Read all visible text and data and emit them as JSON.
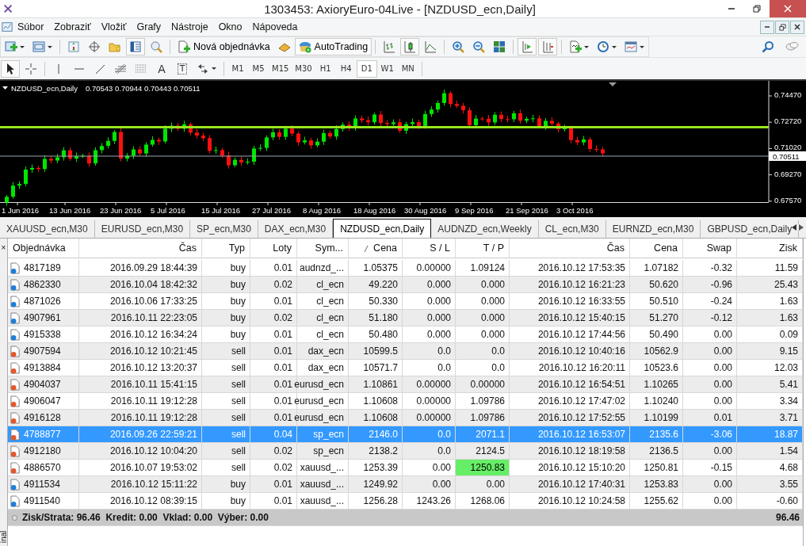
{
  "window": {
    "title": "1303453: AxioryEuro-04Live - [NZDUSD_ecn,Daily]"
  },
  "menu": [
    "Súbor",
    "Zobraziť",
    "Vložiť",
    "Grafy",
    "Nástroje",
    "Okno",
    "Nápoveda"
  ],
  "toolbar": {
    "new_order": "Nová objednávka",
    "autotrading": "AutoTrading"
  },
  "drawing_tools": {
    "text_tool": "A",
    "label_tool": "T"
  },
  "timeframes": [
    {
      "label": "M1",
      "selected": false
    },
    {
      "label": "M5",
      "selected": false
    },
    {
      "label": "M15",
      "selected": false
    },
    {
      "label": "M30",
      "selected": false
    },
    {
      "label": "H1",
      "selected": false
    },
    {
      "label": "H4",
      "selected": false
    },
    {
      "label": "D1",
      "selected": true
    },
    {
      "label": "W1",
      "selected": false
    },
    {
      "label": "MN",
      "selected": false
    }
  ],
  "chart": {
    "symbol": "NZDUSD_ecn,Daily",
    "ohlc": "0.70543 0.70944 0.70443 0.70511",
    "price_labels": [
      "0.74470",
      "0.72720",
      "0.71020",
      "0.69270",
      "0.67570"
    ],
    "current_price": "0.70511",
    "date_labels": [
      "1 Jun 2016",
      "13 Jun 2016",
      "23 Jun 2016",
      "5 Jul 2016",
      "15 Jul 2016",
      "27 Jul 2016",
      "8 Aug 2016",
      "18 Aug 2016",
      "30 Aug 2016",
      "9 Sep 2016",
      "21 Sep 2016",
      "3 Oct 2016"
    ]
  },
  "chart_tabs": [
    {
      "label": "XAUUSD_ecn,M30",
      "selected": false
    },
    {
      "label": "EURUSD_ecn,M30",
      "selected": false
    },
    {
      "label": "SP_ecn,M30",
      "selected": false
    },
    {
      "label": "DAX_ecn,M30",
      "selected": false
    },
    {
      "label": "NZDUSD_ecn,Daily",
      "selected": true
    },
    {
      "label": "AUDNZD_ecn,Weekly",
      "selected": false
    },
    {
      "label": "CL_ecn,M30",
      "selected": false
    },
    {
      "label": "EURNZD_ecn,M30",
      "selected": false
    },
    {
      "label": "GBPUSD_ecn,Daily",
      "selected": false
    }
  ],
  "terminal": {
    "side_label": "inal",
    "close": "×",
    "columns": [
      "Objednávka",
      "Čas",
      "Typ",
      "Loty",
      "Sym...",
      "Cena",
      "S / L",
      "T / P",
      "Čas",
      "Cena",
      "Swap",
      "Zisk"
    ],
    "rows": [
      {
        "kind": "buy",
        "order": "4817189",
        "open_time": "2016.09.29 18:44:39",
        "type": "buy",
        "lots": "0.01",
        "symbol": "audnzd_...",
        "open_price": "1.05375",
        "sl": "0.00000",
        "tp": "1.09124",
        "time": "2016.10.12 17:53:35",
        "price": "1.07182",
        "swap": "-0.32",
        "profit": "11.59",
        "selected": false,
        "tp_hit": false
      },
      {
        "kind": "buy",
        "order": "4862330",
        "open_time": "2016.10.04 18:42:32",
        "type": "buy",
        "lots": "0.02",
        "symbol": "cl_ecn",
        "open_price": "49.220",
        "sl": "0.000",
        "tp": "0.000",
        "time": "2016.10.12 16:21:23",
        "price": "50.620",
        "swap": "-0.96",
        "profit": "25.43",
        "selected": false,
        "tp_hit": false
      },
      {
        "kind": "buy",
        "order": "4871026",
        "open_time": "2016.10.06 17:33:25",
        "type": "buy",
        "lots": "0.01",
        "symbol": "cl_ecn",
        "open_price": "50.330",
        "sl": "0.000",
        "tp": "0.000",
        "time": "2016.10.12 16:33:55",
        "price": "50.510",
        "swap": "-0.24",
        "profit": "1.63",
        "selected": false,
        "tp_hit": false
      },
      {
        "kind": "buy",
        "order": "4907961",
        "open_time": "2016.10.11 22:23:05",
        "type": "buy",
        "lots": "0.02",
        "symbol": "cl_ecn",
        "open_price": "51.180",
        "sl": "0.000",
        "tp": "0.000",
        "time": "2016.10.12 15:40:15",
        "price": "51.270",
        "swap": "-0.12",
        "profit": "1.63",
        "selected": false,
        "tp_hit": false
      },
      {
        "kind": "buy",
        "order": "4915338",
        "open_time": "2016.10.12 16:34:24",
        "type": "buy",
        "lots": "0.01",
        "symbol": "cl_ecn",
        "open_price": "50.480",
        "sl": "0.000",
        "tp": "0.000",
        "time": "2016.10.12 17:44:56",
        "price": "50.490",
        "swap": "0.00",
        "profit": "0.09",
        "selected": false,
        "tp_hit": false
      },
      {
        "kind": "sell",
        "order": "4907594",
        "open_time": "2016.10.12 10:21:45",
        "type": "sell",
        "lots": "0.01",
        "symbol": "dax_ecn",
        "open_price": "10599.5",
        "sl": "0.0",
        "tp": "0.0",
        "time": "2016.10.12 10:40:16",
        "price": "10562.9",
        "swap": "0.00",
        "profit": "9.15",
        "selected": false,
        "tp_hit": false
      },
      {
        "kind": "sell",
        "order": "4913884",
        "open_time": "2016.10.12 13:20:37",
        "type": "sell",
        "lots": "0.01",
        "symbol": "dax_ecn",
        "open_price": "10571.7",
        "sl": "0.0",
        "tp": "0.0",
        "time": "2016.10.12 16:20:11",
        "price": "10523.6",
        "swap": "0.00",
        "profit": "12.03",
        "selected": false,
        "tp_hit": false
      },
      {
        "kind": "sell",
        "order": "4904037",
        "open_time": "2016.10.11 15:41:15",
        "type": "sell",
        "lots": "0.01",
        "symbol": "eurusd_ecn",
        "open_price": "1.10861",
        "sl": "0.00000",
        "tp": "0.00000",
        "time": "2016.10.12 16:54:51",
        "price": "1.10265",
        "swap": "0.00",
        "profit": "5.41",
        "selected": false,
        "tp_hit": false
      },
      {
        "kind": "sell",
        "order": "4906047",
        "open_time": "2016.10.11 19:12:28",
        "type": "sell",
        "lots": "0.01",
        "symbol": "eurusd_ecn",
        "open_price": "1.10608",
        "sl": "0.00000",
        "tp": "1.09786",
        "time": "2016.10.12 17:47:02",
        "price": "1.10240",
        "swap": "0.00",
        "profit": "3.34",
        "selected": false,
        "tp_hit": false
      },
      {
        "kind": "sell",
        "order": "4916128",
        "open_time": "2016.10.11 19:12:28",
        "type": "sell",
        "lots": "0.01",
        "symbol": "eurusd_ecn",
        "open_price": "1.10608",
        "sl": "0.00000",
        "tp": "1.09786",
        "time": "2016.10.12 17:52:55",
        "price": "1.10199",
        "swap": "0.01",
        "profit": "3.71",
        "selected": false,
        "tp_hit": false
      },
      {
        "kind": "sell",
        "order": "4788877",
        "open_time": "2016.09.26 22:59:21",
        "type": "sell",
        "lots": "0.04",
        "symbol": "sp_ecn",
        "open_price": "2146.0",
        "sl": "0.0",
        "tp": "2071.1",
        "time": "2016.10.12 16:53:07",
        "price": "2135.6",
        "swap": "-3.06",
        "profit": "18.87",
        "selected": true,
        "tp_hit": false
      },
      {
        "kind": "sell",
        "order": "4912180",
        "open_time": "2016.10.12 10:04:20",
        "type": "sell",
        "lots": "0.02",
        "symbol": "sp_ecn",
        "open_price": "2138.2",
        "sl": "0.0",
        "tp": "2124.5",
        "time": "2016.10.12 18:19:58",
        "price": "2136.5",
        "swap": "0.00",
        "profit": "1.54",
        "selected": false,
        "tp_hit": false
      },
      {
        "kind": "sell",
        "order": "4886570",
        "open_time": "2016.10.07 19:53:02",
        "type": "sell",
        "lots": "0.02",
        "symbol": "xauusd_...",
        "open_price": "1253.39",
        "sl": "0.00",
        "tp": "1250.83",
        "time": "2016.10.12 15:10:20",
        "price": "1250.81",
        "swap": "-0.15",
        "profit": "4.68",
        "selected": false,
        "tp_hit": true
      },
      {
        "kind": "buy",
        "order": "4911534",
        "open_time": "2016.10.12 15:11:22",
        "type": "buy",
        "lots": "0.01",
        "symbol": "xauusd_...",
        "open_price": "1249.92",
        "sl": "0.00",
        "tp": "0.00",
        "time": "2016.10.12 17:40:31",
        "price": "1253.83",
        "swap": "0.00",
        "profit": "3.55",
        "selected": false,
        "tp_hit": false
      },
      {
        "kind": "buy",
        "order": "4911540",
        "open_time": "2016.10.12 08:39:15",
        "type": "buy",
        "lots": "0.01",
        "symbol": "xauusd_...",
        "open_price": "1256.28",
        "sl": "1243.26",
        "tp": "1268.06",
        "time": "2016.10.12 10:24:58",
        "price": "1255.62",
        "swap": "0.00",
        "profit": "-0.60",
        "selected": false,
        "tp_hit": false
      }
    ],
    "summary": {
      "text": "Zisk/Strata: 96.46  Kredit: 0.00  Vklad: 0.00  Výber: 0.00",
      "total": "96.46"
    }
  }
}
